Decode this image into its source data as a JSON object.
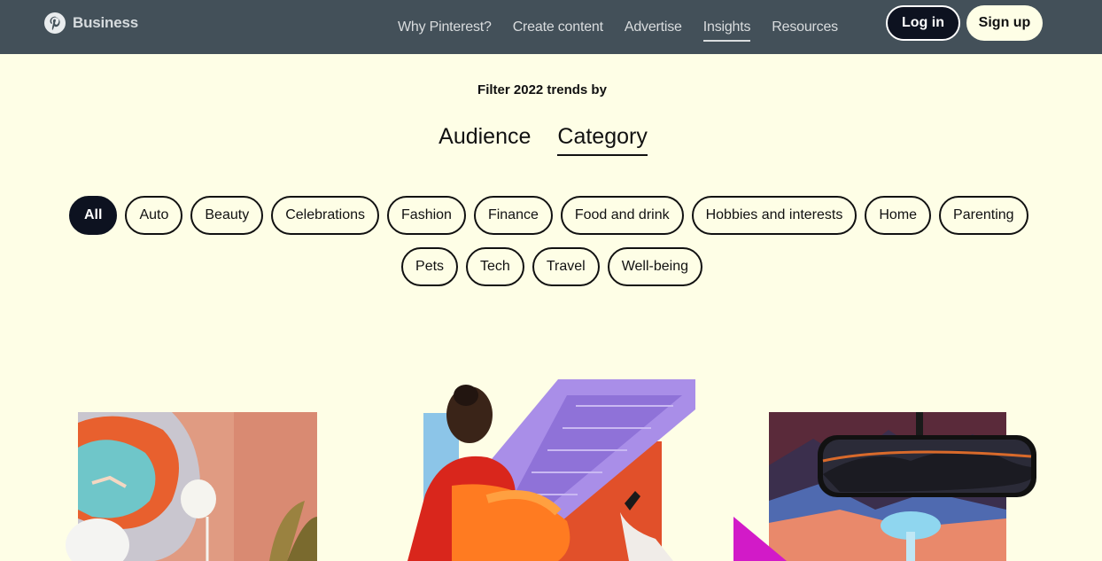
{
  "nav": {
    "brand": "Business",
    "links": [
      "Why Pinterest?",
      "Create content",
      "Advertise",
      "Insights",
      "Resources"
    ],
    "active_link": "Insights",
    "login": "Log in",
    "signup": "Sign up"
  },
  "filter": {
    "title": "Filter 2022 trends by",
    "options": [
      "Audience",
      "Category"
    ],
    "active_option": "Category"
  },
  "categories": {
    "row1": [
      "All",
      "Auto",
      "Beauty",
      "Celebrations",
      "Fashion",
      "Finance",
      "Food and drink",
      "Hobbies and interests",
      "Home",
      "Parenting"
    ],
    "row2": [
      "Pets",
      "Tech",
      "Travel",
      "Well-being"
    ],
    "active": "All"
  },
  "colors": {
    "nav_bg": "#435059",
    "page_bg": "#fefee6",
    "dark": "#0d1220"
  }
}
